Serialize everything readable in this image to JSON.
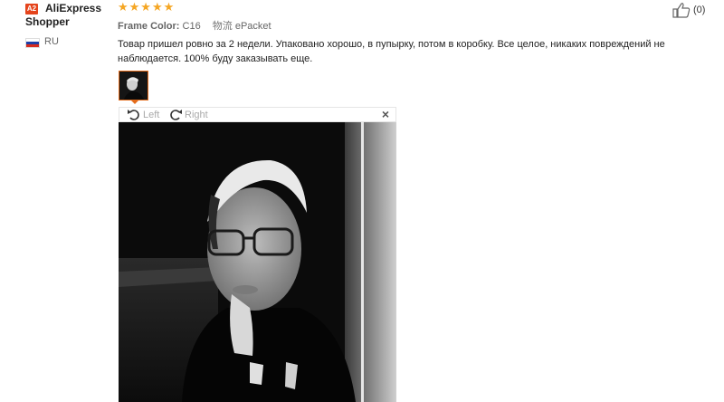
{
  "user": {
    "badge": "A2",
    "name_line1": "AliExpress",
    "name_line2": "Shopper",
    "country": "RU"
  },
  "review": {
    "stars": "★★★★★",
    "rating": 5,
    "attr_label": "Frame Color:",
    "attr_value": "C16",
    "shipping_label": "物流",
    "shipping_value": "ePacket",
    "text": "Товар пришел ровно за 2 недели. Упаковано хорошо, в пупырку, потом в коробку. Все целое, никаких повреждений не наблюдается. 100% буду заказывать еще."
  },
  "viewer": {
    "rotate_left": "Left",
    "rotate_right": "Right",
    "close": "×"
  },
  "helpful": {
    "count": "(0)"
  },
  "colors": {
    "accent": "#e46c1b",
    "stars": "#f5a623",
    "badge": "#e5441c"
  }
}
